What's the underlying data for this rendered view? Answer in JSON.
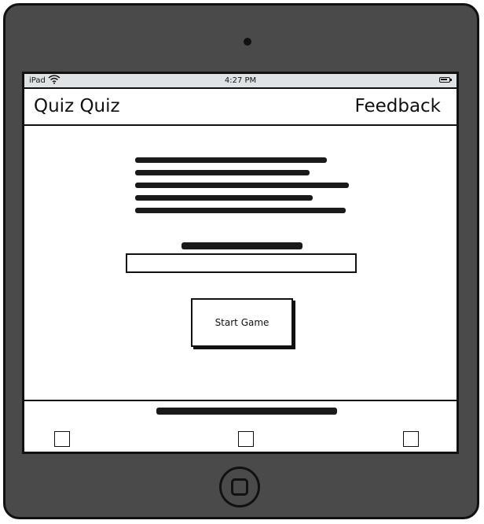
{
  "status_bar": {
    "carrier": "iPad",
    "wifi_icon": "wifi-icon",
    "time": "4:27 PM",
    "battery_icon": "battery-icon"
  },
  "nav": {
    "title": "Quiz Quiz",
    "right_link": "Feedback"
  },
  "main": {
    "start_button_label": "Start Game",
    "name_input_value": ""
  },
  "footer": {
    "checkboxes": [
      "checkbox-left",
      "checkbox-center",
      "checkbox-right"
    ]
  }
}
